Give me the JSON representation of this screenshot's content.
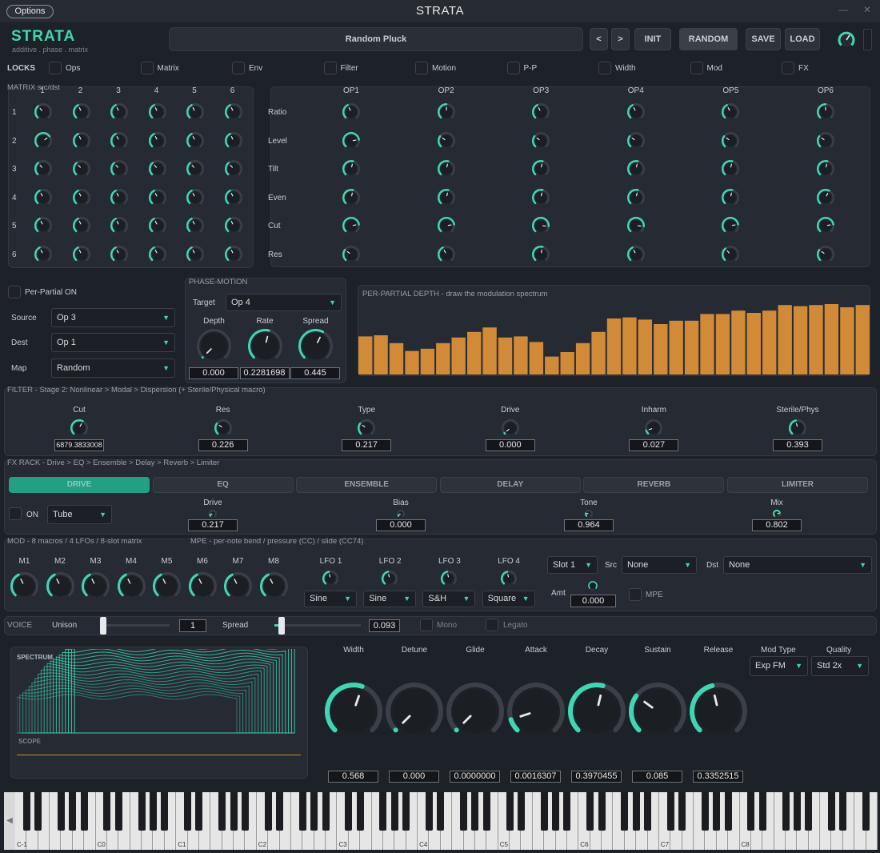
{
  "window": {
    "options": "Options",
    "title": "STRATA"
  },
  "brand": {
    "name": "STRATA",
    "sub": "additive . phase . matrix"
  },
  "preset": {
    "name": "Random Pluck",
    "prev": "<",
    "next": ">",
    "init": "INIT",
    "random": "RANDOM",
    "save": "SAVE",
    "load": "LOAD"
  },
  "locks": {
    "label": "LOCKS",
    "items": [
      "Ops",
      "Matrix",
      "Env",
      "Filter",
      "Motion",
      "P-P",
      "Width",
      "Mod",
      "FX"
    ]
  },
  "matrix": {
    "label": "MATRIX src/dst",
    "cols": [
      "1",
      "2",
      "3",
      "4",
      "5",
      "6"
    ],
    "rows": [
      "1",
      "2",
      "3",
      "4",
      "5",
      "6"
    ]
  },
  "ops": {
    "cols": [
      "OP1",
      "OP2",
      "OP3",
      "OP4",
      "OP5",
      "OP6"
    ],
    "rows": [
      "Ratio",
      "Level",
      "Tilt",
      "Even",
      "Cut",
      "Res"
    ]
  },
  "perpartial": {
    "toggle": "Per-Partial ON",
    "source_label": "Source",
    "source": "Op 3",
    "dest_label": "Dest",
    "dest": "Op 1",
    "map_label": "Map",
    "map": "Random"
  },
  "phase": {
    "label": "PHASE-MOTION",
    "target_label": "Target",
    "target": "Op 4",
    "knobs": [
      {
        "label": "Depth",
        "value": "0.000"
      },
      {
        "label": "Rate",
        "value": "0.2281698"
      },
      {
        "label": "Spread",
        "value": "0.445"
      }
    ]
  },
  "depth": {
    "label": "PER-PARTIAL DEPTH  -  draw the modulation spectrum",
    "bars": [
      0.34,
      0.35,
      0.28,
      0.21,
      0.23,
      0.28,
      0.33,
      0.38,
      0.42,
      0.33,
      0.34,
      0.29,
      0.16,
      0.2,
      0.28,
      0.38,
      0.5,
      0.51,
      0.49,
      0.45,
      0.48,
      0.48,
      0.54,
      0.54,
      0.57,
      0.55,
      0.57,
      0.62,
      0.61,
      0.62,
      0.64,
      0.6,
      0.62
    ]
  },
  "filter": {
    "label": "FILTER  -  Stage 2:  Nonlinear > Modal > Dispersion   (+ Sterile/Physical macro)",
    "knobs": [
      {
        "label": "Cut",
        "value": "6879.3833008"
      },
      {
        "label": "Res",
        "value": "0.226"
      },
      {
        "label": "Type",
        "value": "0.217"
      },
      {
        "label": "Drive",
        "value": "0.000"
      },
      {
        "label": "Inharm",
        "value": "0.027"
      },
      {
        "label": "Sterile/Phys",
        "value": "0.393"
      }
    ]
  },
  "fx": {
    "label": "FX RACK  -  Drive > EQ > Ensemble > Delay > Reverb > Limiter",
    "tabs": [
      "DRIVE",
      "EQ",
      "ENSEMBLE",
      "DELAY",
      "REVERB",
      "LIMITER"
    ],
    "on": "ON",
    "mode": "Tube",
    "knobs": [
      {
        "label": "Drive",
        "value": "0.217"
      },
      {
        "label": "Bias",
        "value": "0.000"
      },
      {
        "label": "Tone",
        "value": "0.964"
      },
      {
        "label": "Mix",
        "value": "0.802"
      }
    ]
  },
  "mod": {
    "label": "MOD  -  8 macros  /  4 LFOs  /  8-slot matrix",
    "mpe_label": "MPE  -  per-note bend / pressure (CC) / slide (CC74)",
    "macros": [
      "M1",
      "M2",
      "M3",
      "M4",
      "M5",
      "M6",
      "M7",
      "M8"
    ],
    "lfos": [
      {
        "label": "LFO 1",
        "shape": "Sine"
      },
      {
        "label": "LFO 2",
        "shape": "Sine"
      },
      {
        "label": "LFO 3",
        "shape": "S&H"
      },
      {
        "label": "LFO 4",
        "shape": "Square"
      }
    ],
    "slot": "Slot 1",
    "src_label": "Src",
    "src": "None",
    "dst_label": "Dst",
    "dst": "None",
    "amt_label": "Amt",
    "amt": "0.000",
    "mpe": "MPE"
  },
  "voice": {
    "label": "VOICE",
    "unison_label": "Unison",
    "unison": "1",
    "spread_label": "Spread",
    "spread": "0.093",
    "mono": "Mono",
    "legato": "Legato"
  },
  "scope": {
    "spectrum": "SPECTRUM",
    "scope": "SCOPE"
  },
  "env": {
    "knobs": [
      {
        "label": "Width",
        "value": "0.568",
        "level": 0.57
      },
      {
        "label": "Detune",
        "value": "0.000",
        "level": 0.0
      },
      {
        "label": "Glide",
        "value": "0.0000000",
        "level": 0.0
      },
      {
        "label": "Attack",
        "value": "0.0016307",
        "level": 0.1
      },
      {
        "label": "Decay",
        "value": "0.3970455",
        "level": 0.55
      },
      {
        "label": "Sustain",
        "value": "0.085",
        "level": 0.3
      },
      {
        "label": "Release",
        "value": "0.3352515",
        "level": 0.45
      }
    ],
    "modtype_label": "Mod Type",
    "modtype": "Exp FM",
    "quality_label": "Quality",
    "quality": "Std 2x"
  },
  "keyboard": {
    "octaves": [
      "C-1",
      "C0",
      "C1",
      "C2",
      "C3",
      "C4",
      "C5",
      "C6",
      "C7",
      "C8"
    ]
  },
  "colors": {
    "accent": "#3fd6b4",
    "bar": "#d08a38",
    "bg": "#1d2128"
  }
}
